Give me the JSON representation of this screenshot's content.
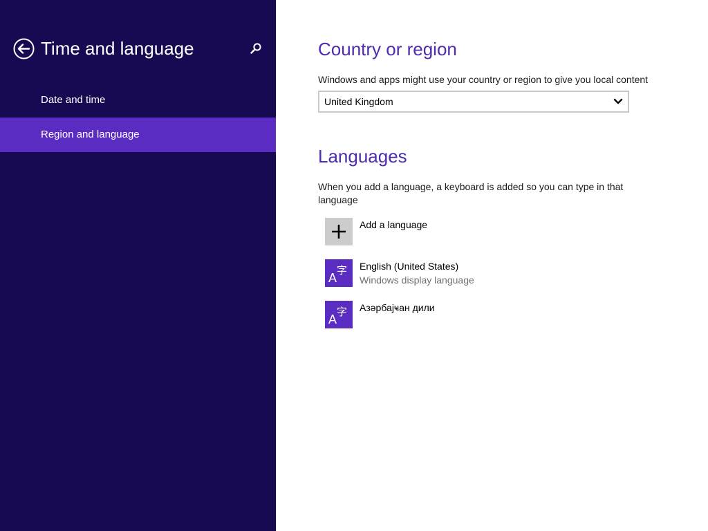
{
  "sidebar": {
    "title": "Time and language",
    "items": [
      {
        "label": "Date and time",
        "selected": false
      },
      {
        "label": "Region and language",
        "selected": true
      }
    ]
  },
  "country_section": {
    "title": "Country or region",
    "description": "Windows and apps might use your country or region to give you local content",
    "selected_country": "United Kingdom"
  },
  "languages_section": {
    "title": "Languages",
    "description": "When you add a language, a keyboard is added so you can type in that language",
    "add_label": "Add a language",
    "languages": [
      {
        "name": "English (United States)",
        "subtitle": "Windows display language"
      },
      {
        "name": "Азәрбајҹан дили",
        "subtitle": ""
      }
    ]
  },
  "icons": {
    "back": "back-arrow-icon",
    "search": "search-icon",
    "dropdown": "chevron-down-icon",
    "add": "plus-icon",
    "language": "language-icon"
  },
  "colors": {
    "sidebar_bg": "#180a52",
    "selected_item_bg": "#5a2cc2",
    "accent_text": "#4f2bb0",
    "language_tile": "#5a2cc2",
    "add_tile": "#cccccc"
  }
}
